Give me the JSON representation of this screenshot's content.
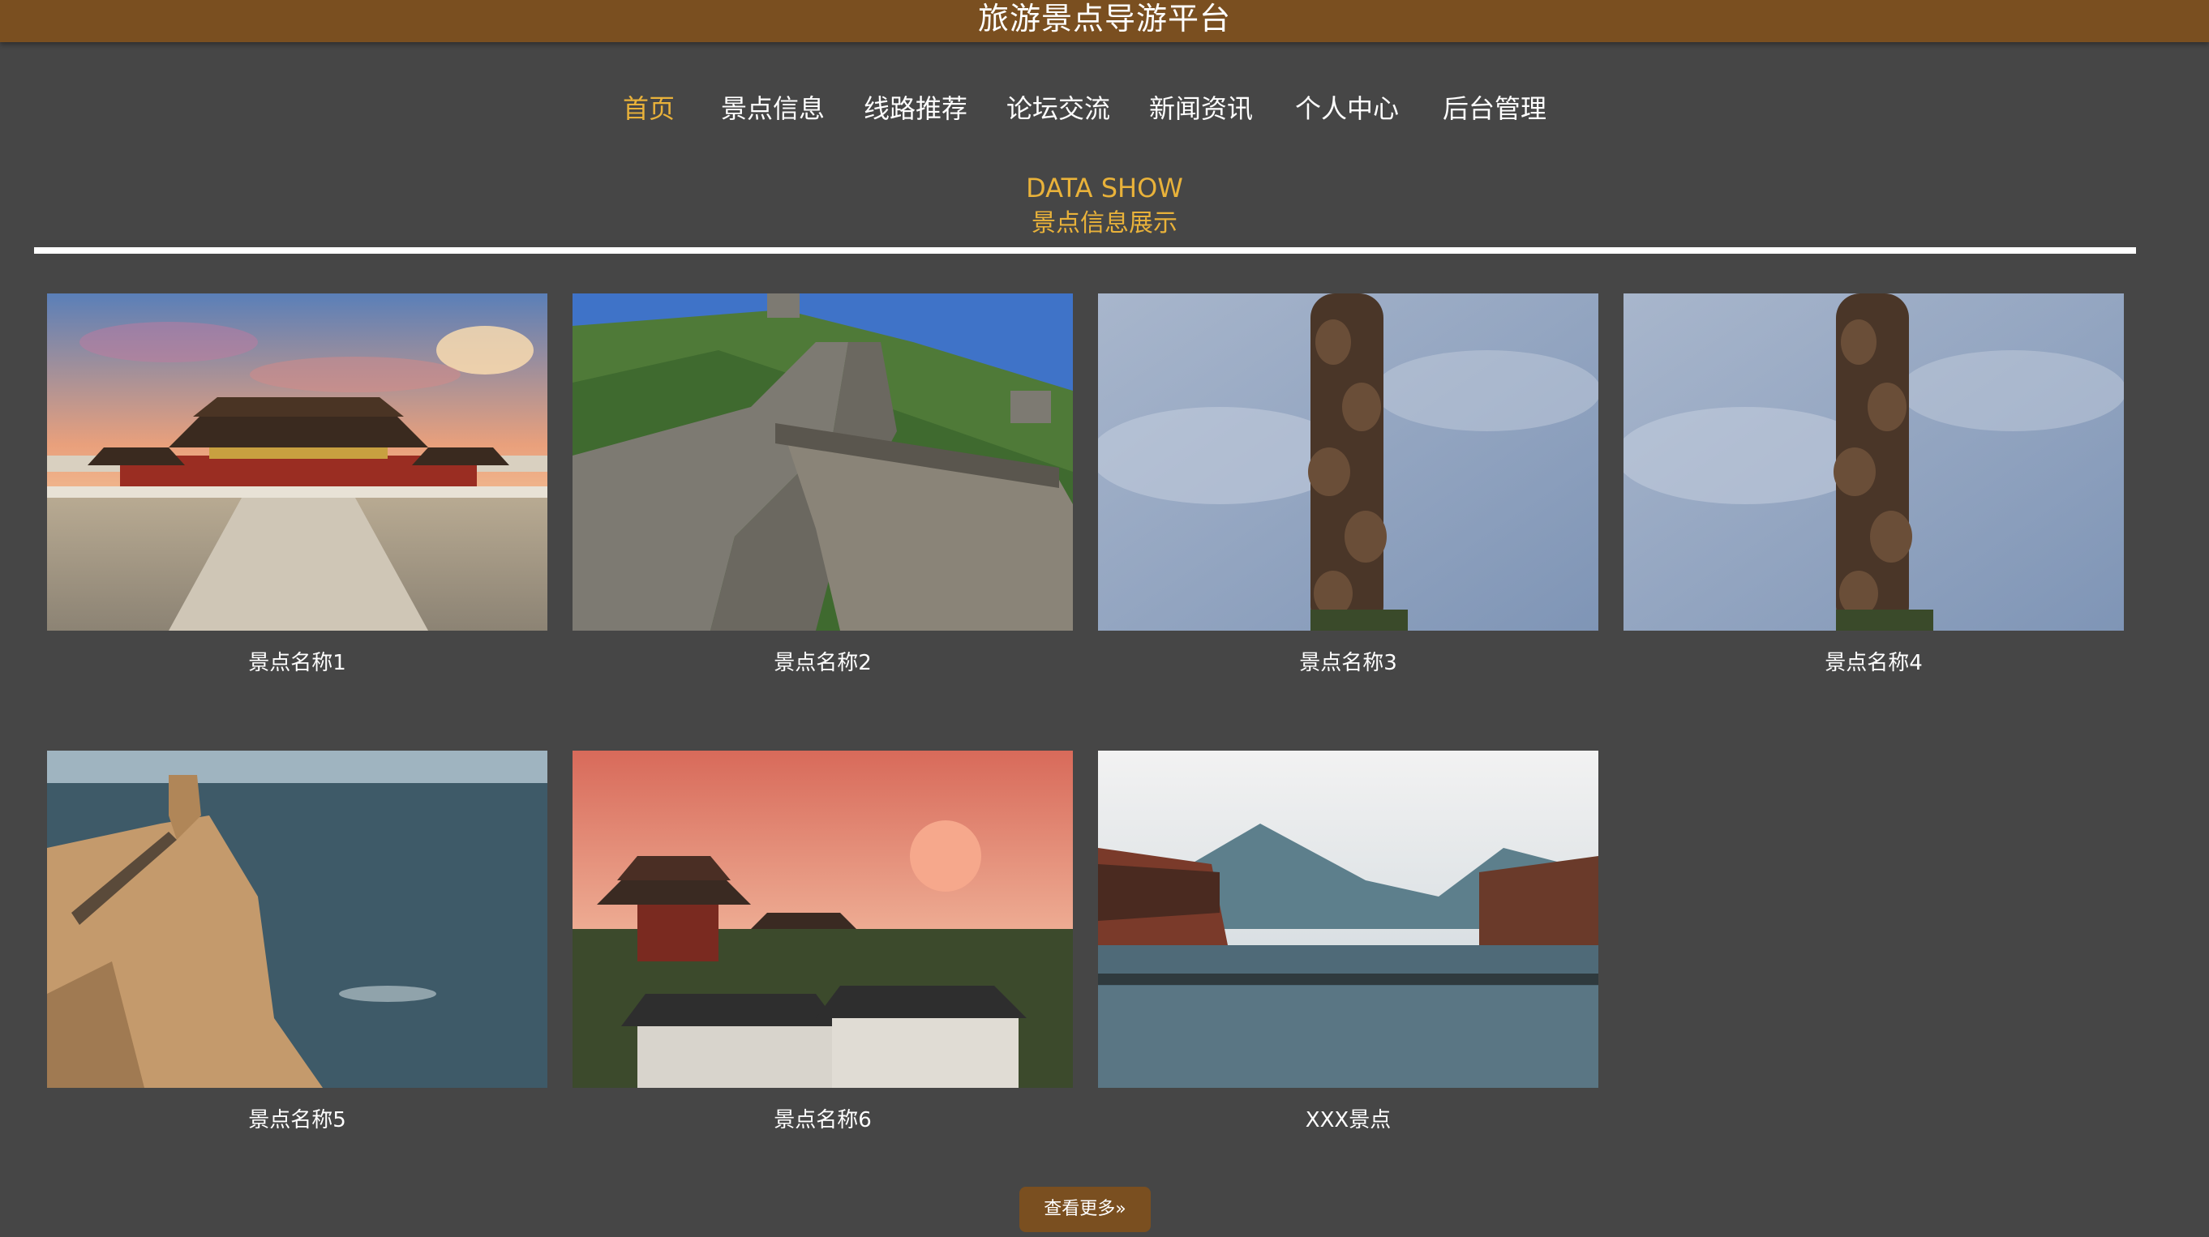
{
  "header": {
    "title": "旅游景点导游平台"
  },
  "nav": {
    "items": [
      {
        "label": "首页",
        "active": true
      },
      {
        "label": "景点信息"
      },
      {
        "label": "线路推荐"
      },
      {
        "label": "论坛交流"
      },
      {
        "label": "新闻资讯"
      },
      {
        "label": "个人中心"
      },
      {
        "label": "后台管理"
      }
    ]
  },
  "section": {
    "title_en": "DATA SHOW",
    "title_zh": "景点信息展示"
  },
  "attractions": [
    {
      "name": "景点名称1",
      "image": "palace-photo"
    },
    {
      "name": "景点名称2",
      "image": "great-wall-photo"
    },
    {
      "name": "景点名称3",
      "image": "totem-pole-photo"
    },
    {
      "name": "景点名称4",
      "image": "totem-pole-photo"
    },
    {
      "name": "景点名称5",
      "image": "sea-cliff-photo"
    },
    {
      "name": "景点名称6",
      "image": "pavilion-sunset-photo"
    },
    {
      "name": "XXX景点",
      "image": "river-town-photo"
    }
  ],
  "more_button": {
    "label": "查看更多",
    "icon": "double-chevron-right-icon"
  },
  "colors": {
    "background": "#464646",
    "header": "#7a4f20",
    "accent": "#e9b23a",
    "text": "#ffffff"
  }
}
